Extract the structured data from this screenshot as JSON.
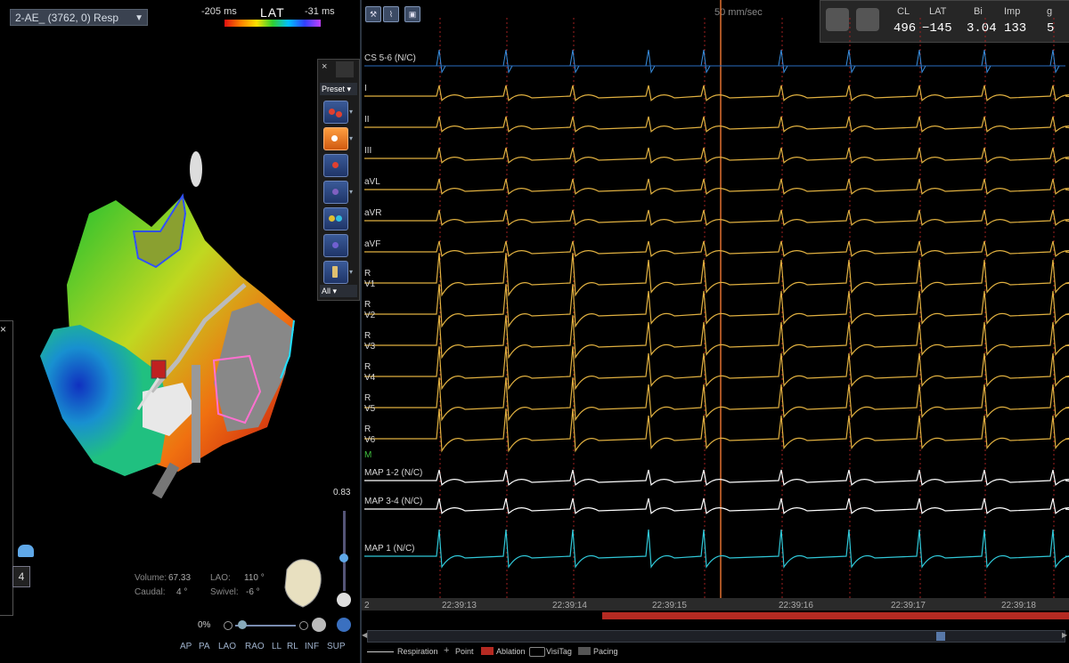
{
  "map_panel": {
    "map_selector": "2-AE_  (3762, 0) Resp",
    "lat_min": "-205 ms",
    "lat_title": "LAT",
    "lat_max": "-31 ms",
    "toolbar": {
      "close": "×",
      "preset": "Preset",
      "all": "All"
    },
    "stats": {
      "volume_label": "Volume:",
      "volume_value": "67.33",
      "lao_label": "LAO:",
      "lao_value": "110 °",
      "caudal_label": "Caudal:",
      "caudal_value": "4  °",
      "swivel_label": "Swivel:",
      "swivel_value": "-6  °"
    },
    "zoom_percent": "0%",
    "vertical_slider_value": "0.83",
    "views": [
      "AP",
      "PA",
      "LAO",
      "RAO",
      "LL",
      "RL",
      "INF",
      "SUP"
    ],
    "side_number": "4",
    "side_close": "×",
    "colors": {
      "lat_gradient": [
        "#e01010",
        "#ff8000",
        "#ffe000",
        "#30d030",
        "#00c0ff",
        "#3040ff",
        "#c040ff"
      ]
    }
  },
  "ep_panel": {
    "sweep_speed": "50 mm/sec",
    "readout": {
      "headers": [
        "CL",
        "LAT",
        "Bi",
        "Imp",
        "g"
      ],
      "values": [
        "496",
        "−145",
        "3.04",
        "133",
        "5"
      ]
    },
    "channels": [
      {
        "label": "CS 5-6 (N/C)",
        "color": "#3a8fe0"
      },
      {
        "label": "I",
        "color": "#e0b040"
      },
      {
        "label": "II",
        "color": "#e0b040"
      },
      {
        "label": "III",
        "color": "#e0b040"
      },
      {
        "label": "aVL",
        "color": "#e0b040"
      },
      {
        "label": "aVR",
        "color": "#e0b040"
      },
      {
        "label": "aVF",
        "color": "#e0b040"
      },
      {
        "label": "V1",
        "color": "#e0b040",
        "prefix": "R"
      },
      {
        "label": "V2",
        "color": "#e0b040",
        "prefix": "R"
      },
      {
        "label": "V3",
        "color": "#e0b040",
        "prefix": "R"
      },
      {
        "label": "V4",
        "color": "#e0b040",
        "prefix": "R"
      },
      {
        "label": "V5",
        "color": "#e0b040",
        "prefix": "R"
      },
      {
        "label": "V6",
        "color": "#e0b040",
        "prefix": "R"
      },
      {
        "label": "M",
        "color": "#40c040"
      },
      {
        "label": "MAP 1-2 (N/C)",
        "color": "#ffffff"
      },
      {
        "label": "MAP 3-4 (N/C)",
        "color": "#ffffff"
      },
      {
        "label": "MAP 1  (N/C)",
        "color": "#30c8d8"
      }
    ],
    "timeline": {
      "left_marker": "2",
      "ticks": [
        "22:39:13",
        "22:39:14",
        "22:39:15",
        "22:39:16",
        "22:39:17",
        "22:39:18"
      ]
    },
    "legend": [
      "Respiration",
      "Point",
      "Ablation",
      "VisiTag",
      "Pacing"
    ]
  }
}
